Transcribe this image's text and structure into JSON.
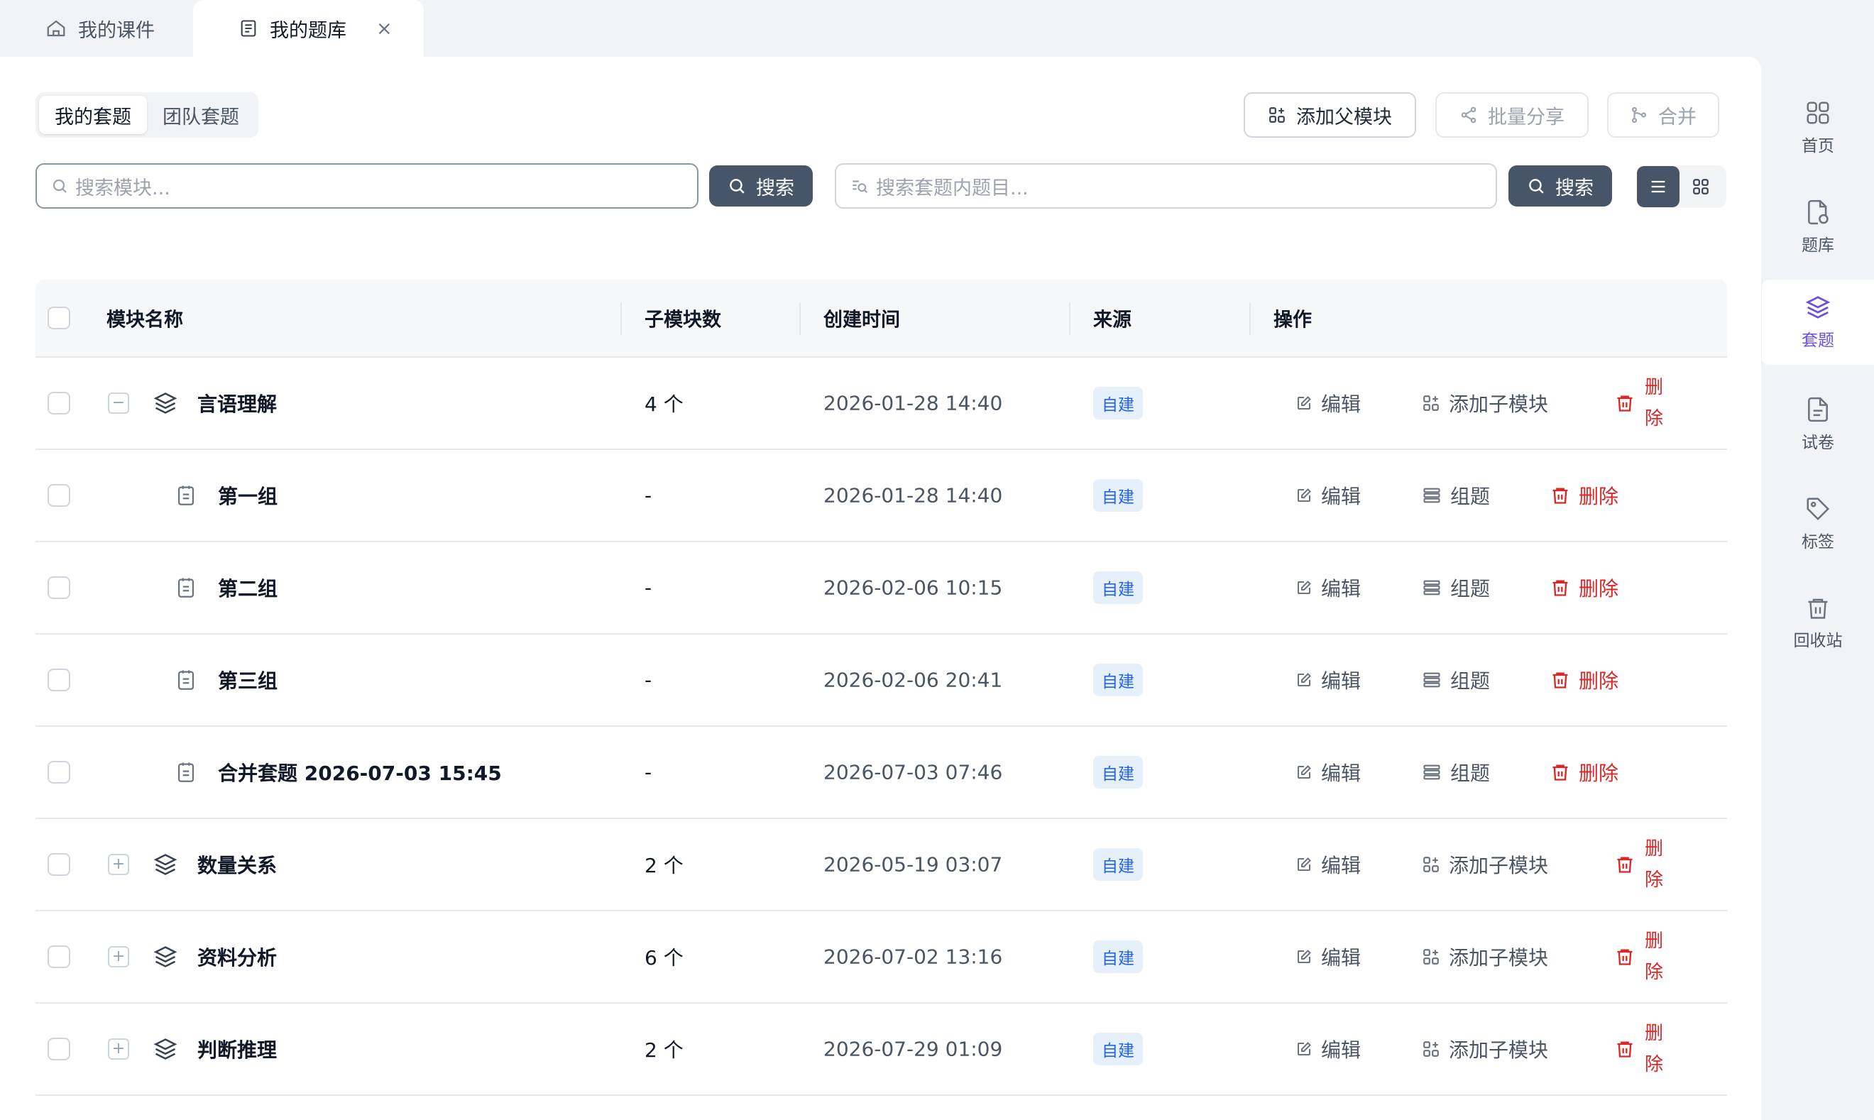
{
  "tabs": [
    {
      "label": "我的课件",
      "icon": "home-icon"
    },
    {
      "label": "我的题库",
      "icon": "question-bank-icon",
      "close": "×"
    }
  ],
  "segment": [
    "我的套题",
    "团队套题"
  ],
  "toolbar": {
    "add_parent": "添加父模块",
    "batch_share": "批量分享",
    "merge": "合并"
  },
  "search": {
    "module_placeholder": "搜索模块...",
    "module_button": "搜索",
    "question_placeholder": "搜索套题内题目...",
    "question_button": "搜索"
  },
  "table": {
    "headers": {
      "name": "模块名称",
      "children": "子模块数",
      "created": "创建时间",
      "source": "来源",
      "actions": "操作"
    },
    "rows": [
      {
        "type": "parent",
        "expanded": true,
        "name": "言语理解",
        "count": "4 个",
        "time": "2026-01-28 14:40",
        "source": "自建"
      },
      {
        "type": "child",
        "name": "第一组",
        "count": "-",
        "time": "2026-01-28 14:40",
        "source": "自建"
      },
      {
        "type": "child",
        "name": "第二组",
        "count": "-",
        "time": "2026-02-06 10:15",
        "source": "自建"
      },
      {
        "type": "child",
        "name": "第三组",
        "count": "-",
        "time": "2026-02-06 20:41",
        "source": "自建"
      },
      {
        "type": "child",
        "name": "合并套题 2026-07-03 15:45",
        "count": "-",
        "time": "2026-07-03 07:46",
        "source": "自建"
      },
      {
        "type": "parent",
        "expanded": false,
        "name": "数量关系",
        "count": "2 个",
        "time": "2026-05-19 03:07",
        "source": "自建"
      },
      {
        "type": "parent",
        "expanded": false,
        "name": "资料分析",
        "count": "6 个",
        "time": "2026-07-02 13:16",
        "source": "自建"
      },
      {
        "type": "parent",
        "expanded": false,
        "name": "判断推理",
        "count": "2 个",
        "time": "2026-07-29 01:09",
        "source": "自建"
      }
    ],
    "actions": {
      "edit": "编辑",
      "add_child": "添加子模块",
      "group": "组题",
      "delete": "删除",
      "delete_v1": "删",
      "delete_v2": "除"
    }
  },
  "sidebar": [
    {
      "label": "首页",
      "icon": "home-grid-icon"
    },
    {
      "label": "题库",
      "icon": "question-bank-icon"
    },
    {
      "label": "套题",
      "icon": "layers-icon",
      "active": true
    },
    {
      "label": "试卷",
      "icon": "paper-icon"
    },
    {
      "label": "标签",
      "icon": "tag-icon"
    },
    {
      "label": "回收站",
      "icon": "trash-icon"
    }
  ],
  "colors": {
    "accent": "#6d4fe0",
    "primary_button": "#475569",
    "danger": "#dc2626",
    "badge_text": "#2563eb",
    "badge_bg": "#e6f0fb"
  }
}
